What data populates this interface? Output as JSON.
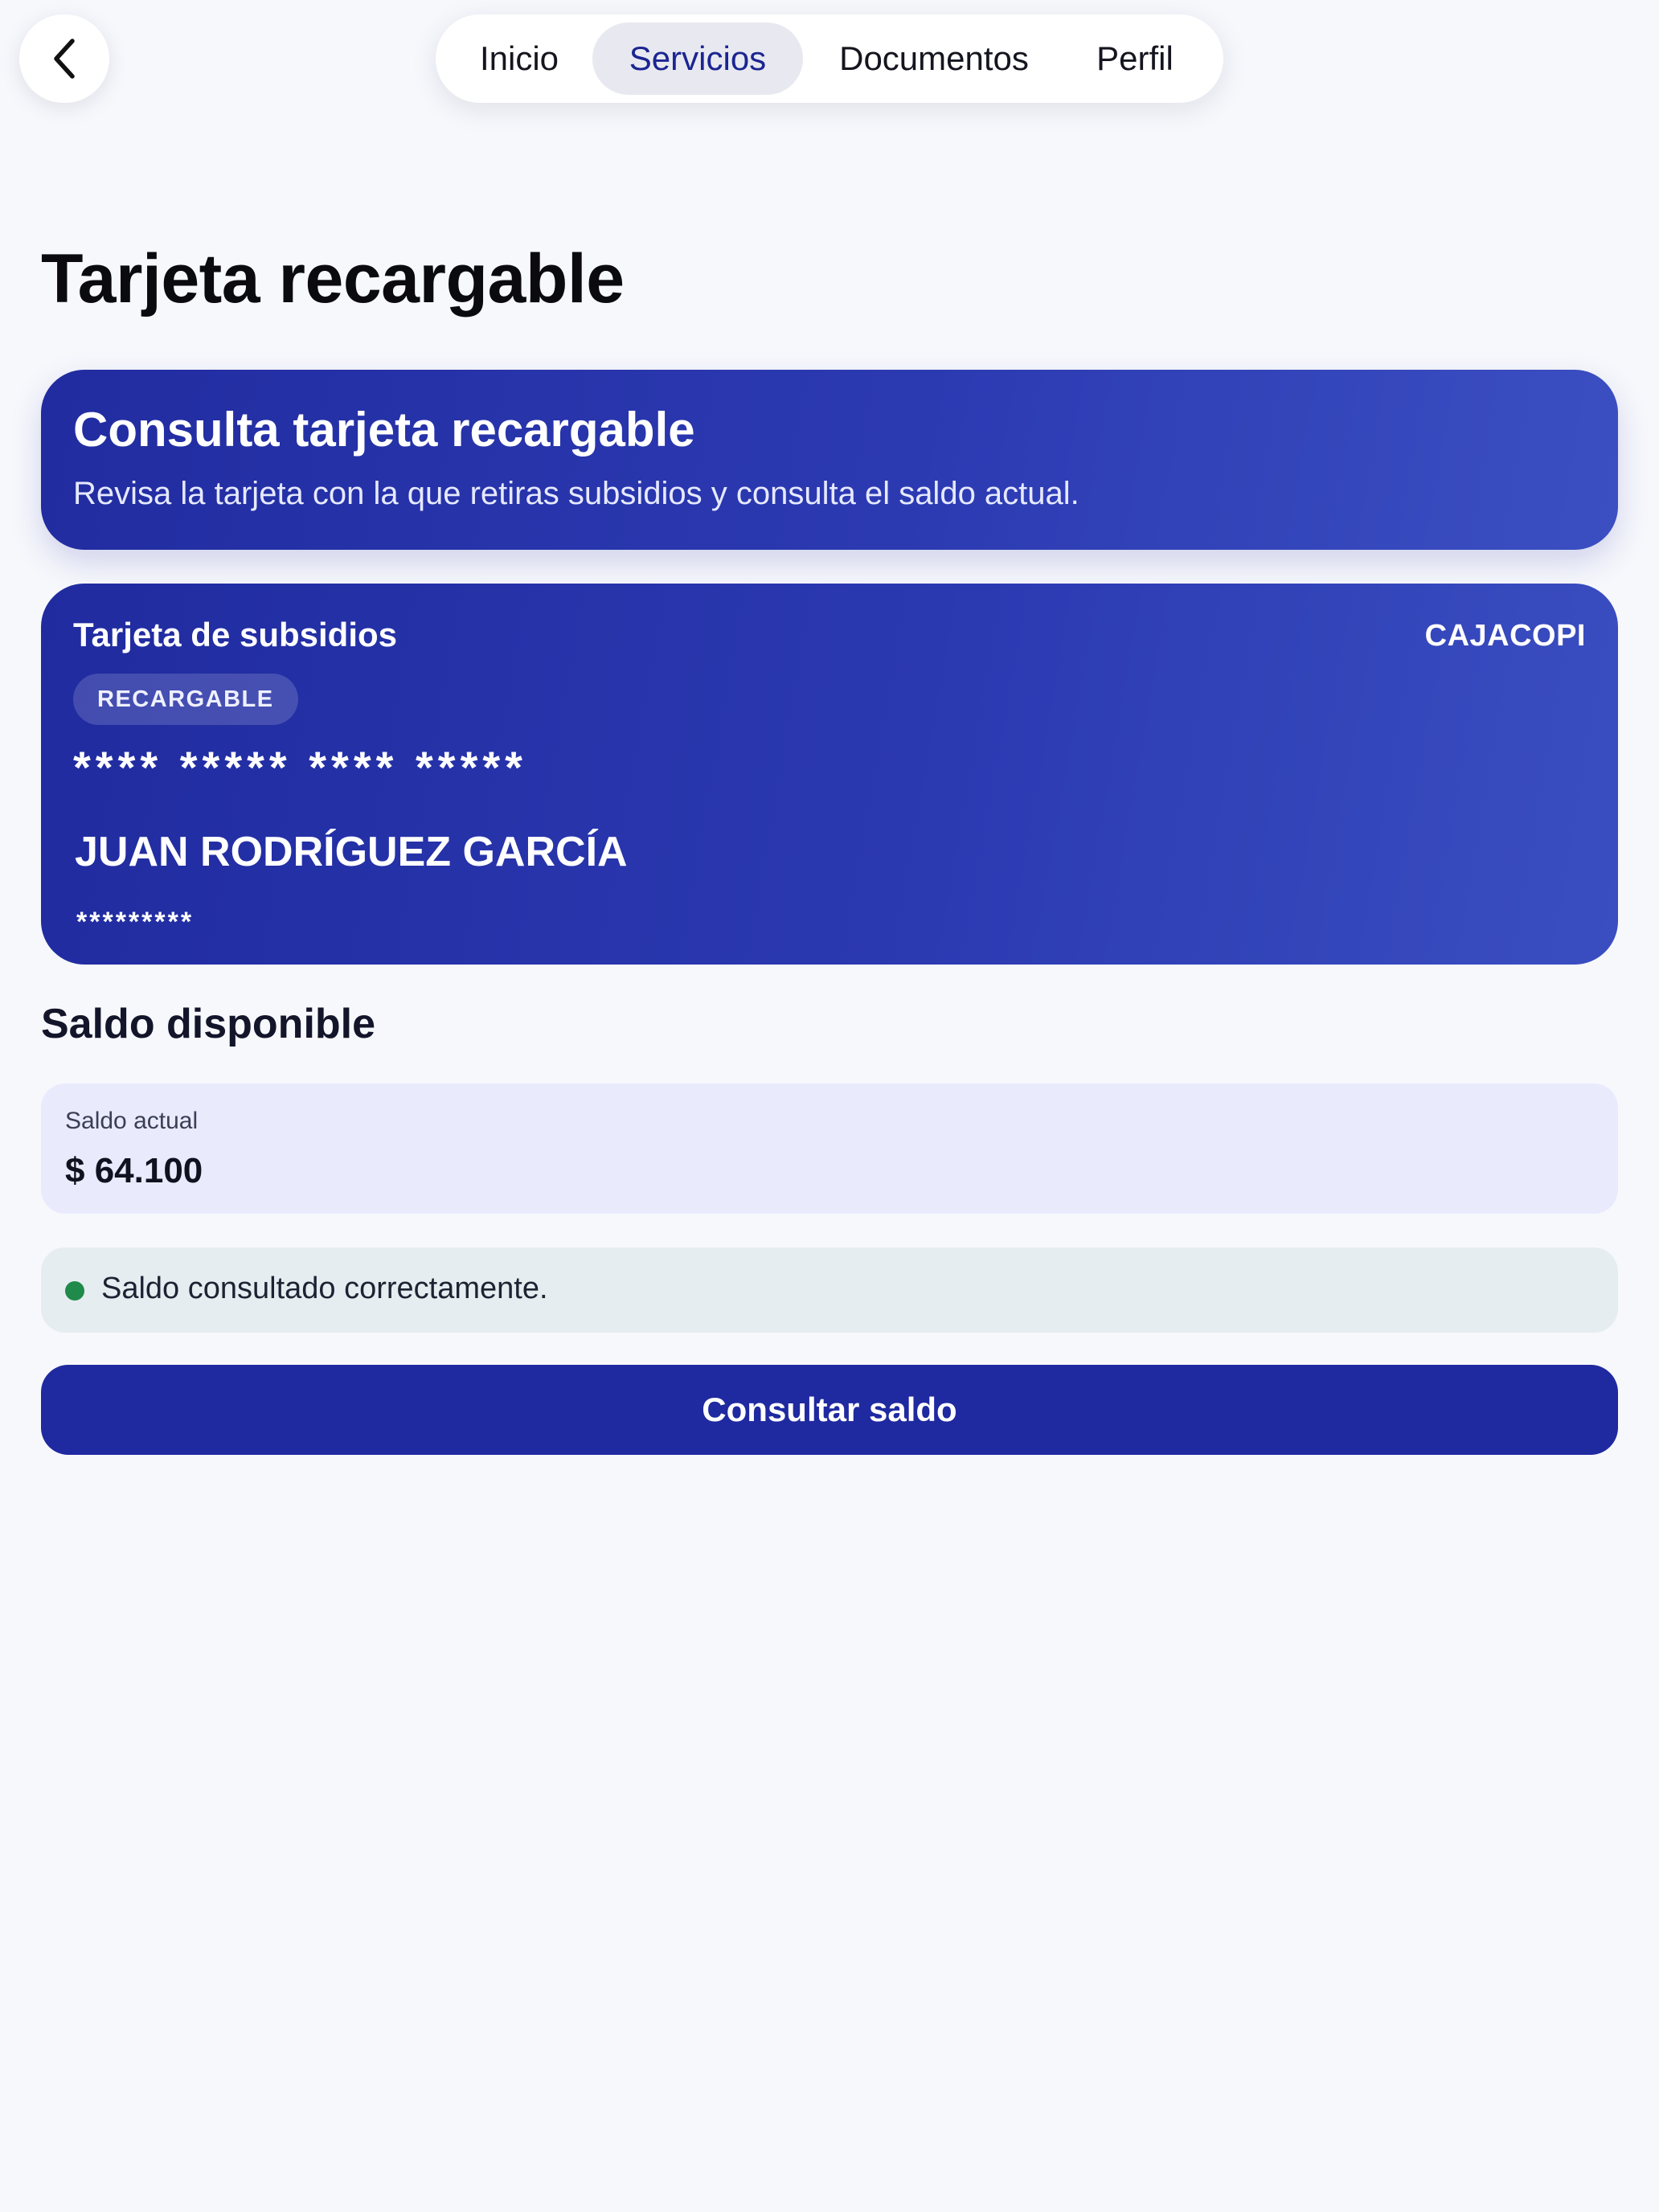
{
  "nav": {
    "back_icon": "chevron-left-icon",
    "tabs": [
      {
        "label": "Inicio",
        "active": false
      },
      {
        "label": "Servicios",
        "active": true
      },
      {
        "label": "Documentos",
        "active": false
      },
      {
        "label": "Perfil",
        "active": false
      }
    ]
  },
  "page": {
    "title": "Tarjeta recargable"
  },
  "banner": {
    "title": "Consulta tarjeta recargable",
    "subtitle": "Revisa la tarjeta con la que retiras subsidios y consulta el saldo actual."
  },
  "card": {
    "title": "Tarjeta de subsidios",
    "brand": "CAJACOPI",
    "badge": "RECARGABLE",
    "number_masked": "**** ***** **** *****",
    "holder": "JUAN RODRÍGUEZ GARCÍA",
    "document_masked": "*********"
  },
  "balance": {
    "section_title": "Saldo disponible",
    "label": "Saldo actual",
    "value": "$ 64.100"
  },
  "status": {
    "text": "Saldo consultado correctamente.",
    "color": "#1f8a4a"
  },
  "actions": {
    "check_balance": "Consultar saldo"
  },
  "colors": {
    "primary": "#1f29a0",
    "background": "#f7f8fc",
    "active_tab_text": "#1b2591"
  }
}
